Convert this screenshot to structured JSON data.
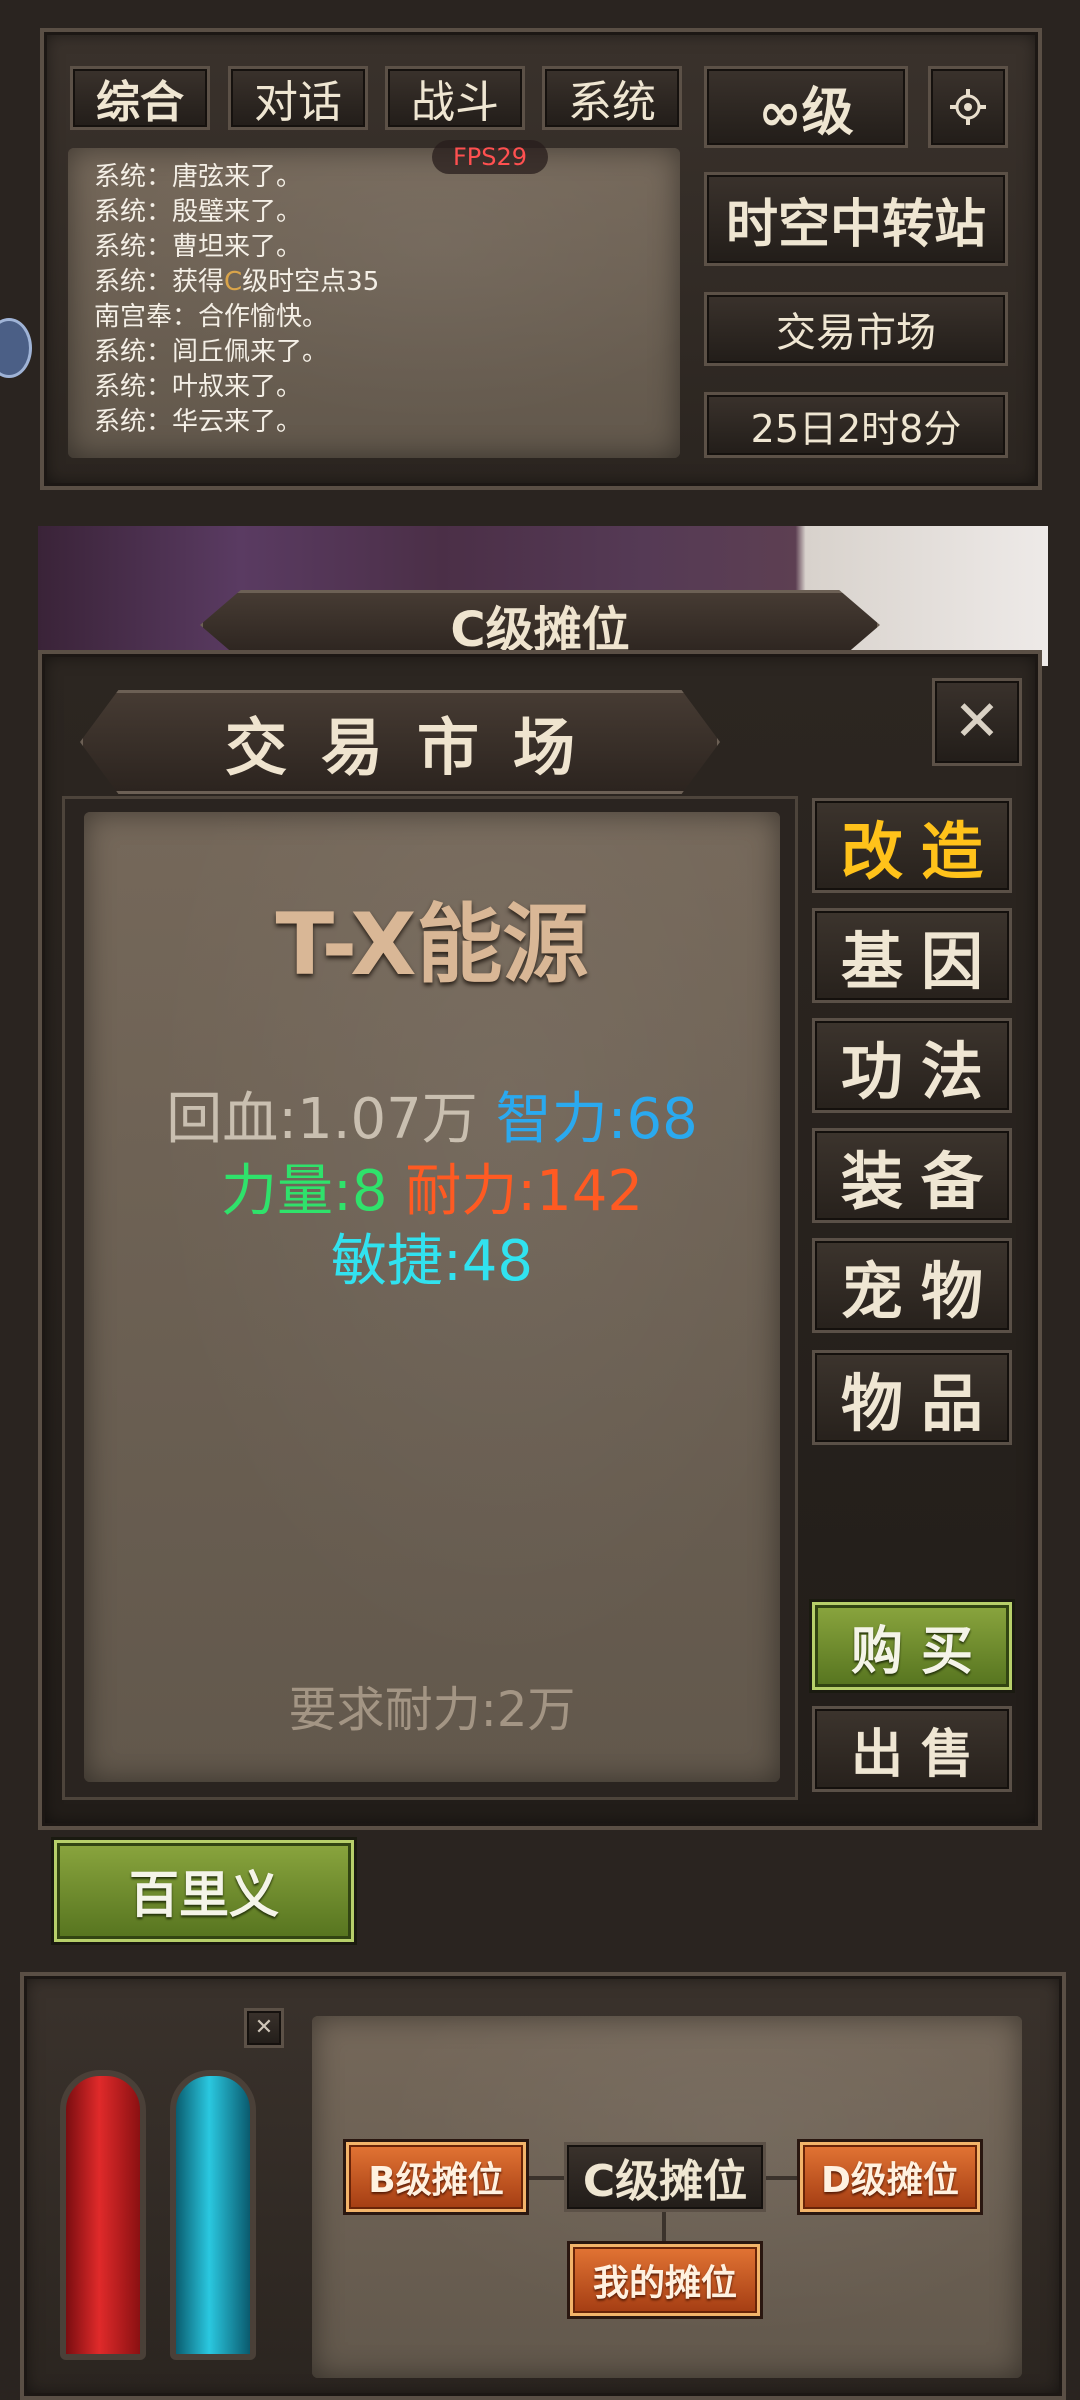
{
  "chat": {
    "tabs": [
      "综合",
      "对话",
      "战斗",
      "系统"
    ],
    "fps": "FPS29",
    "messages": [
      {
        "prefix": "系统：唐弦来了。"
      },
      {
        "prefix": "系统：殷璧来了。"
      },
      {
        "prefix": "系统：曹坦来了。"
      },
      {
        "prefix": "系统：获得",
        "highlight": "C",
        "suffix": "级时空点35"
      },
      {
        "prefix": "南宫奉：合作愉快。"
      },
      {
        "prefix": "系统：闾丘佩来了。"
      },
      {
        "prefix": "系统：叶叔来了。"
      },
      {
        "prefix": "系统：华云来了。"
      }
    ]
  },
  "top_right": {
    "level": "∞级",
    "station": "时空中转站",
    "market": "交易市场",
    "time": "25日2时8分"
  },
  "background_banner": "C级摊位",
  "panel": {
    "title": "交易市场",
    "item_name": "T-X能源",
    "stats": {
      "hp": "回血:1.07万",
      "int": "智力:68",
      "str": "力量:8",
      "end": "耐力:142",
      "agi": "敏捷:48"
    },
    "requirement": "要求耐力:2万",
    "categories": [
      "改造",
      "基因",
      "功法",
      "装备",
      "宠物",
      "物品"
    ],
    "active_category": "改造",
    "buy": "购买",
    "sell": "出售"
  },
  "seller": "百里义",
  "bottom": {
    "stalls": {
      "b": "B级摊位",
      "c": "C级摊位",
      "d": "D级摊位",
      "mine": "我的摊位"
    }
  },
  "colors": {
    "hp": "#c9bfb0",
    "int": "#2aa9ef",
    "str": "#2fe26b",
    "end": "#ff5a22",
    "agi": "#31e2ef",
    "active_category": "#ffc21a"
  }
}
